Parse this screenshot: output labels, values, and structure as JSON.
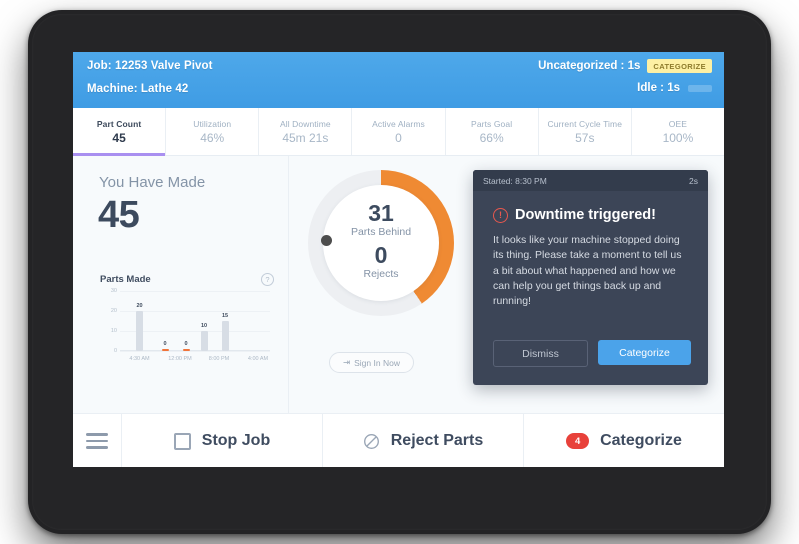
{
  "header": {
    "job": "Job: 12253 Valve Pivot",
    "machine": "Machine: Lathe 42",
    "uncategorized": "Uncategorized : 1s",
    "categorize_badge": "CATEGORIZE",
    "idle": "Idle : 1s"
  },
  "kpis": [
    {
      "label": "Part Count",
      "value": "45",
      "active": true
    },
    {
      "label": "Utilization",
      "value": "46%",
      "active": false
    },
    {
      "label": "All Downtime",
      "value": "45m 21s",
      "active": false
    },
    {
      "label": "Active Alarms",
      "value": "0",
      "active": false
    },
    {
      "label": "Parts Goal",
      "value": "66%",
      "active": false
    },
    {
      "label": "Current Cycle Time",
      "value": "57s",
      "active": false
    },
    {
      "label": "OEE",
      "value": "100%",
      "active": false
    }
  ],
  "made": {
    "label": "You Have Made",
    "value": "45"
  },
  "parts_made": {
    "title": "Parts Made",
    "help_icon": "question-mark-icon"
  },
  "chart_data": {
    "type": "bar",
    "title": "Parts Made",
    "xlabel": "",
    "ylabel": "",
    "ylim": [
      0,
      30
    ],
    "yticks": [
      0,
      10,
      20,
      30
    ],
    "grid": true,
    "legend": "none",
    "categories": [
      "4:30 AM",
      "",
      "12:00 PM",
      "8:00 PM",
      ""
    ],
    "x_tick_labels": [
      "4:30 AM",
      "12:00 PM",
      "8:00 PM",
      "4:00 AM"
    ],
    "values": [
      20,
      0,
      0,
      10,
      15
    ],
    "data_labels": [
      "20",
      "0",
      "0",
      "10",
      "15"
    ],
    "bar_color": "#d7dde5",
    "zero_bar_color": "#f0743a"
  },
  "gauge": {
    "parts_behind_value": "31",
    "parts_behind_label": "Parts Behind",
    "rejects_value": "0",
    "rejects_label": "Rejects",
    "arc_percent": 40,
    "arc_color": "#ef8a33",
    "track_color": "#edeff2",
    "sign_in_label": "Sign In Now",
    "sign_in_icon": "sign-in-icon"
  },
  "downtime": {
    "started": "Started: 8:30 PM",
    "elapsed": "2s",
    "title": "Downtime triggered!",
    "alert_icon": "alert-circle-icon",
    "message": "It looks like your machine stopped doing its thing. Please take a moment to tell us a bit about what happened and how we can help you get things back up and running!",
    "dismiss_label": "Dismiss",
    "categorize_label": "Categorize"
  },
  "footer": {
    "menu_icon": "hamburger-menu-icon",
    "stop_job_label": "Stop Job",
    "stop_job_icon": "stop-square-icon",
    "reject_parts_label": "Reject Parts",
    "reject_parts_icon": "no-entry-icon",
    "categorize_label": "Categorize",
    "categorize_count": "4"
  },
  "colors": {
    "header_blue": "#4aa3e8",
    "accent_purple": "#a98ff0",
    "orange": "#ef8a33",
    "red": "#e8413a",
    "panel_dark": "#3c4557"
  }
}
